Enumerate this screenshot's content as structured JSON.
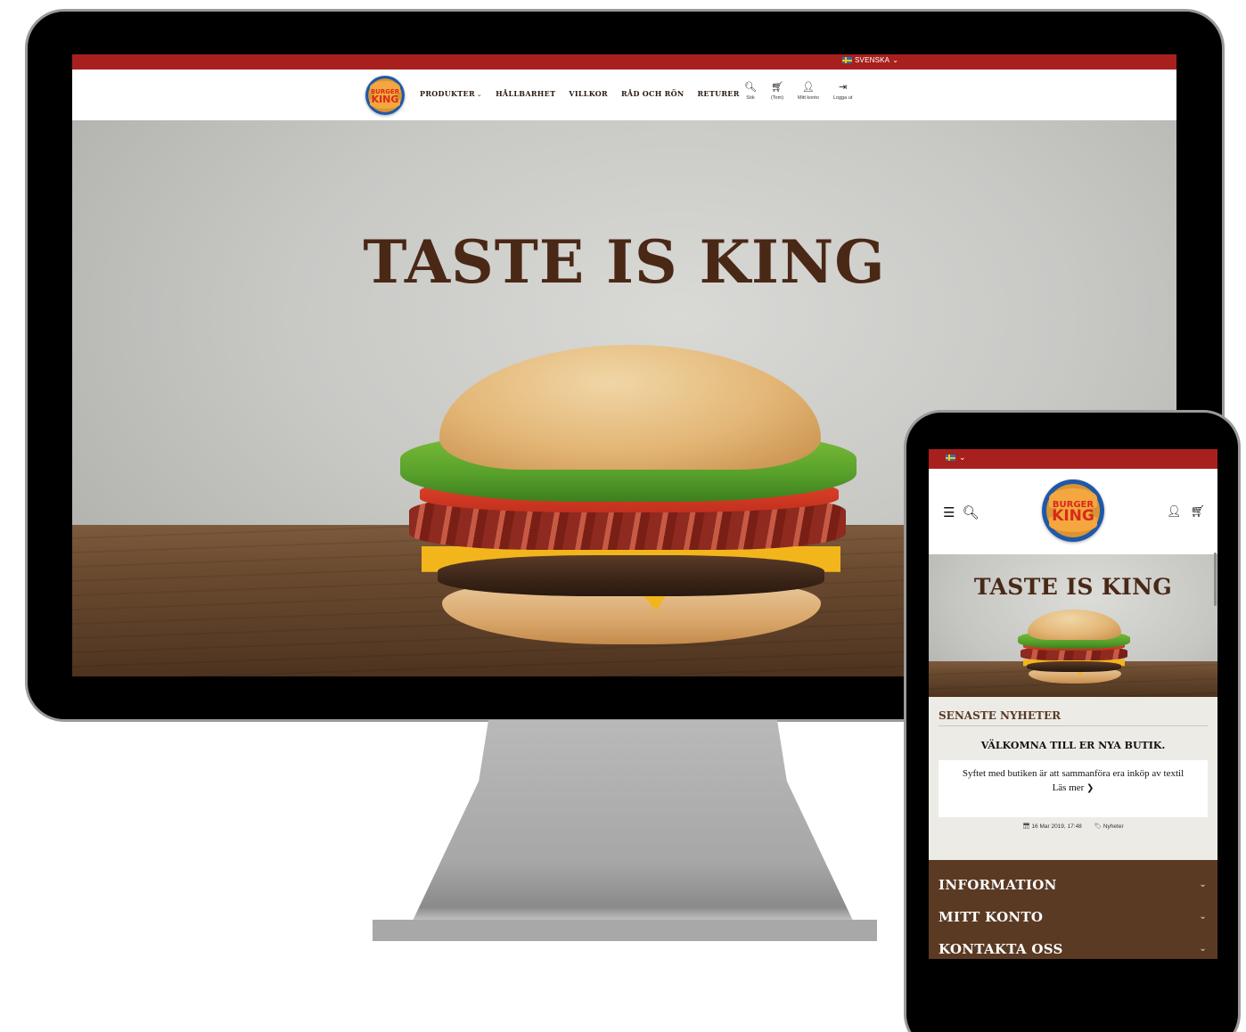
{
  "desktop": {
    "language": "SVENSKA",
    "nav": {
      "menu": [
        "PRODUKTER",
        "HÅLLBARHET",
        "VILLKOR",
        "RÅD OCH RÖN",
        "RETURER"
      ],
      "icons": [
        {
          "icon": "search-icon",
          "glyph": "🔍︎",
          "label": "Sök"
        },
        {
          "icon": "cart-icon",
          "glyph": "🛒︎",
          "label": "(Tom)"
        },
        {
          "icon": "user-icon",
          "glyph": "👤︎",
          "label": "Mitt konto"
        },
        {
          "icon": "logout-icon",
          "glyph": "⇥",
          "label": "Logga ut"
        }
      ]
    },
    "logo": {
      "line1": "BURGER",
      "line2": "KING"
    },
    "hero_title": "TASTE IS KING"
  },
  "mobile": {
    "logo": {
      "line1": "BURGER",
      "line2": "KING"
    },
    "hero_title": "TASTE IS KING",
    "news": {
      "heading": "SENASTE NYHETER",
      "title": "VÄLKOMNA TILL ER NYA BUTIK.",
      "text": "Syftet med butiken är att sammanföra era inköp av textil",
      "more": "Läs mer",
      "date": "16 Mar 2019, 17:48",
      "tag": "Nyheter"
    },
    "footer": [
      "INFORMATION",
      "MITT KONTO",
      "KONTAKTA OSS"
    ]
  },
  "colors": {
    "brand_red": "#a8201e",
    "brown": "#5b3a23",
    "title_brown": "#4a2816"
  }
}
